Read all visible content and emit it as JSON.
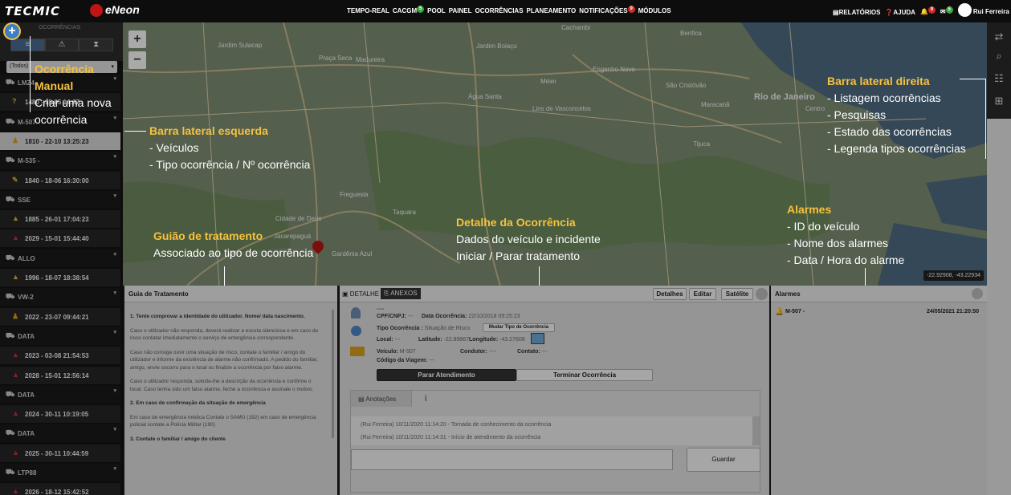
{
  "header": {
    "logo_left": "TECMIC",
    "logo_right": "eNeon",
    "nav": [
      {
        "label": "TEMPO-REAL"
      },
      {
        "label": "CACGM",
        "badge": "5"
      },
      {
        "label": "POOL"
      },
      {
        "label": "PAINEL"
      },
      {
        "label": "OCORRÊNCIAS"
      },
      {
        "label": "PLANEAMENTO"
      },
      {
        "label": "NOTIFICAÇÕES",
        "badge": "9"
      },
      {
        "label": "MÓDULOS"
      }
    ],
    "relatorios": "RELATÓRIOS",
    "ajuda": "AJUDA",
    "alerts_badge": "9",
    "mail_badge": "5",
    "user": "Rui Ferreira"
  },
  "leftbar": {
    "heading": "OCORRÊNCIAS",
    "filter": "(Todos)",
    "rows": [
      {
        "type": "veh",
        "icon": "truck-icon",
        "text": "LMZ4"
      },
      {
        "type": "occ",
        "icon": "question-icon",
        "text": "1480 - 18-05 14:37"
      },
      {
        "type": "veh",
        "icon": "truck-icon",
        "text": "M-507"
      },
      {
        "type": "sel",
        "icon": "person-icon",
        "text": "1810 - 22-10 13:25:23"
      },
      {
        "type": "veh",
        "icon": "truck-icon",
        "text": "M-535 -"
      },
      {
        "type": "occ",
        "icon": "wrench-icon",
        "text": "1840 - 18-06 16:30:00"
      },
      {
        "type": "veh",
        "icon": "truck-icon",
        "text": "SSE"
      },
      {
        "type": "occ",
        "icon": "warning-yellow-icon",
        "text": "1885 - 26-01 17:04:23"
      },
      {
        "type": "occ",
        "icon": "warning-red-icon",
        "text": "2029 - 15-01 15:44:40"
      },
      {
        "type": "veh",
        "icon": "truck-icon",
        "text": "ALLO"
      },
      {
        "type": "occ",
        "icon": "warning-yellow-icon",
        "text": "1996 - 18-07 18:38:54"
      },
      {
        "type": "veh",
        "icon": "truck-icon",
        "text": "VW-2"
      },
      {
        "type": "occ",
        "icon": "person-icon",
        "text": "2022 - 23-07 09:44:21"
      },
      {
        "type": "veh",
        "icon": "truck-icon",
        "text": "DATA"
      },
      {
        "type": "occ",
        "icon": "warning-red-icon",
        "text": "2023 - 03-08 21:54:53"
      },
      {
        "type": "occ",
        "icon": "warning-red-icon",
        "text": "2028 - 15-01 12:56:14"
      },
      {
        "type": "veh",
        "icon": "truck-icon",
        "text": "DATA"
      },
      {
        "type": "occ",
        "icon": "warning-red-icon",
        "text": "2024 - 30-11 10:19:05"
      },
      {
        "type": "veh",
        "icon": "truck-icon",
        "text": "DATA"
      },
      {
        "type": "occ",
        "icon": "warning-red-icon",
        "text": "2025 - 30-11 10:44:59"
      },
      {
        "type": "veh",
        "icon": "truck-icon",
        "text": "LTP88"
      },
      {
        "type": "occ",
        "icon": "warning-red-icon",
        "text": "2026 - 18-12 15:42:52"
      }
    ]
  },
  "map": {
    "labels": [
      "Cachambi",
      "Benfica",
      "Jardim Sulacap",
      "Praça Seca",
      "Madureira",
      "Jardim Boiaçu",
      "Engenho Novo",
      "São Cristóvão",
      "Méier",
      "Água Santa",
      "Lins de Vasconcelos",
      "Rio de Janeiro",
      "Maracanã",
      "Centro",
      "Tijuca",
      "Freguesia",
      "Cidade de Deus",
      "Taquara",
      "Jacarepaguá",
      "Gardênia Azul"
    ],
    "coords": "-22.92908, -43.22934"
  },
  "guia": {
    "title": "Guia de Tratamento",
    "paragraphs": [
      {
        "bold": true,
        "text": "1. Tente comprovar a identidade do utilizador. Nome/ data nascimento."
      },
      {
        "bold": false,
        "text": "Caso o utilizador não responda, deverá realizar a escuta silenciosa e em caso de risco contatar imediatamente o serviço de emergência correspondente."
      },
      {
        "bold": false,
        "text": "Caso não consiga ouvir uma situação de risco, contate o familiar / amigo do utilizador e informe da existência de alarme não confirmado. A pedido do familiar, amigo, envie socorro para o local ou finalize a ocorrência por falso alarme."
      },
      {
        "bold": false,
        "text": "Caso o utilizador responda, solicite-lhe a descrição da ocorrência e confirme o local. Caso tenha sido um falso alarme, feche a ocorrência e assinale o motivo."
      },
      {
        "bold": true,
        "text": "2. Em caso de confirmação da situação de emergência"
      },
      {
        "bold": false,
        "text": "Em caso de emergência médica Contate o SAMU (192) em caso de emergência policial contate a Polícia Militar (190)"
      },
      {
        "bold": true,
        "text": "3. Contate o familiar / amigo do cliente"
      }
    ]
  },
  "detalhe": {
    "tab_detalhe": "DETALHE",
    "tab_anexos": "ANEXOS",
    "btn_detalhes": "Detalhes",
    "btn_editar": "Editar",
    "btn_satelite": "Satélite",
    "name": "----",
    "cpf_label": "CPF/CNPJ:",
    "cpf_value": "---",
    "data_label": "Data Ocorrência:",
    "data_value": "22/10/2018 09:25:23",
    "tipo_label": "Tipo Ocorrência :",
    "tipo_value": "Situação de Risco",
    "mudar_tipo": "Mudar Tipo de Ocorrência",
    "local_label": "Local:",
    "local_value": "---",
    "lat_label": "Latitude:",
    "lat_value": "-22.89867",
    "lon_label": "Longitude:",
    "lon_value": "-43.27608",
    "veiculo_label": "Veículo:",
    "veiculo_value": "M-507",
    "condutor_label": "Condutor:",
    "condutor_value": "----",
    "contato_label": "Contato:",
    "contato_value": "---",
    "codigo_label": "Código da Viagem:",
    "codigo_value": "---",
    "parar": "Parar Atendimento",
    "terminar": "Terminar Ocorrência",
    "tab_anotacoes": "Anotações",
    "tab_info": "i",
    "log": [
      "(Rui Ferreira)  10/11/2020 11:14:20 - Tomada de conhecimento da ocorrência",
      "(Rui Ferreira)  10/11/2020 11:14:31 - Início de atendimento da ocorrência"
    ],
    "guardar": "Guardar"
  },
  "alarmes": {
    "title": "Alarmes",
    "rows": [
      {
        "vehicle": "M-507 -",
        "time": "24/05/2021 21:20:50"
      }
    ]
  },
  "annotations": {
    "ocorrencia_manual": {
      "t1": "Ocorrência",
      "t2": "Manual",
      "l1": "Criar uma nova",
      "l2": "ocorrência"
    },
    "barra_esquerda": {
      "title": "Barra lateral esquerda",
      "l1": "- Veículos",
      "l2": "- Tipo ocorrência / Nº ocorrência"
    },
    "barra_direita": {
      "title": "Barra lateral direita",
      "l1": "- Listagem ocorrências",
      "l2": "- Pesquisas",
      "l3": "- Estado das ocorrências",
      "l4": "- Legenda tipos ocorrências"
    },
    "alarmes": {
      "title": "Alarmes",
      "l1": "- ID do veículo",
      "l2": "- Nome dos alarmes",
      "l3": "- Data / Hora do alarme"
    },
    "detalhe": {
      "title": "Detalhe da Ocorrência",
      "l1": "Dados do veículo e incidente",
      "l2": "Iniciar / Parar tratamento"
    },
    "guiao": {
      "title": "Guião de tratamento",
      "l1": "Associado ao tipo de ocorrência"
    }
  }
}
